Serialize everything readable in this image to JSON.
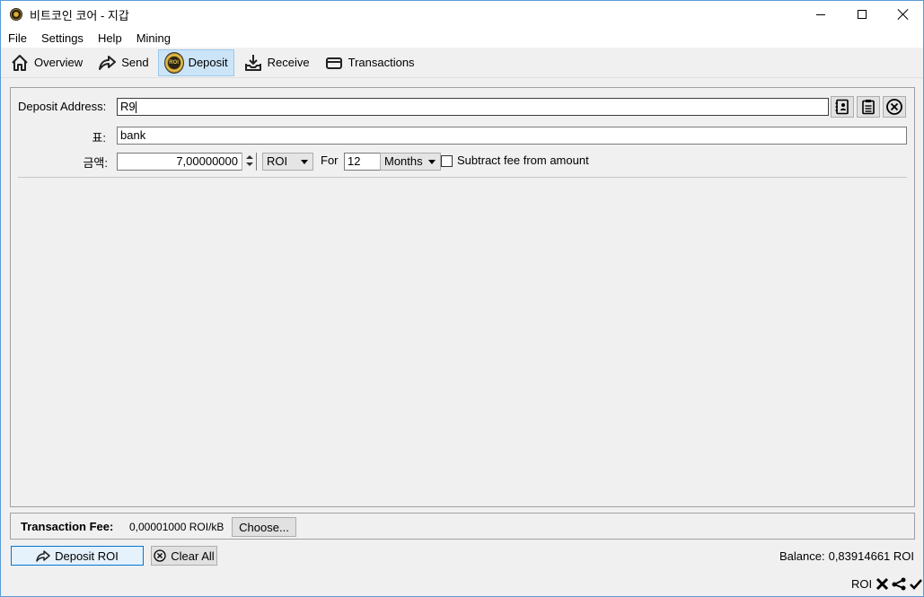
{
  "window": {
    "title": "비트코인 코어 - 지갑"
  },
  "menu": [
    "File",
    "Settings",
    "Help",
    "Mining"
  ],
  "toolbar": {
    "overview": "Overview",
    "send": "Send",
    "deposit": "Deposit",
    "deposit_logo_text": "ROI",
    "receive": "Receive",
    "transactions": "Transactions"
  },
  "form": {
    "address_label": "Deposit Address:",
    "address_value": "R9",
    "label_label": "표:",
    "label_value": "bank",
    "amount_label": "금액:",
    "amount_value": "7,00000000",
    "unit": "ROI",
    "for_label": "For",
    "period_value": "12",
    "period_unit": "Months",
    "subtract_fee_label": "Subtract fee from amount"
  },
  "fee": {
    "label": "Transaction Fee:",
    "value": "0,00001000 ROI/kB",
    "choose_button": "Choose..."
  },
  "actions": {
    "deposit_button": "Deposit ROI",
    "clear_all_button": "Clear All"
  },
  "balance": {
    "label": "Balance:",
    "value": "0,83914661 ROI"
  },
  "status": {
    "unit": "ROI"
  }
}
